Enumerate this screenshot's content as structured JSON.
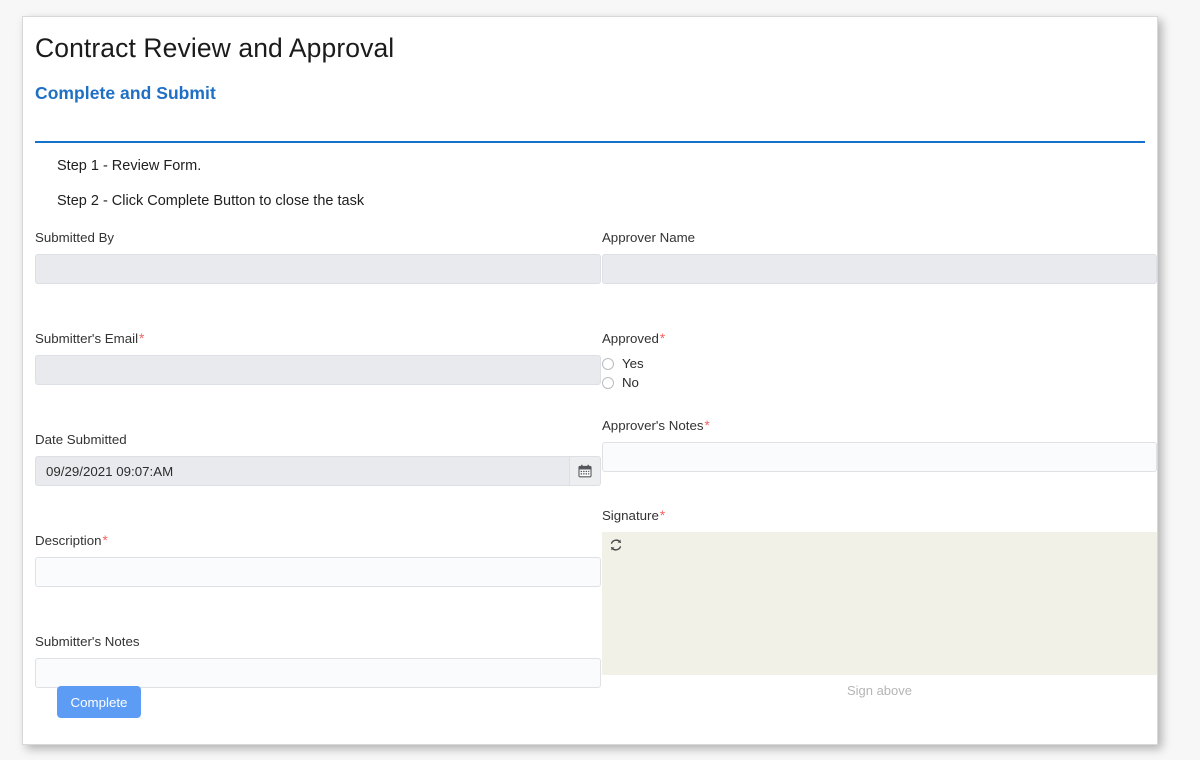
{
  "form": {
    "title": "Contract Review and Approval",
    "subtitle": "Complete and Submit",
    "steps": [
      "Step 1 - Review Form.",
      "Step 2 - Click Complete Button to close the task"
    ],
    "accent_color": "#1472cc",
    "required_marker": "*"
  },
  "left_column": {
    "submitted_by": {
      "label": "Submitted By",
      "value": "",
      "required": false,
      "disabled": true
    },
    "submitter_email": {
      "label": "Submitter's Email",
      "value": "",
      "required": true,
      "disabled": true
    },
    "date_submitted": {
      "label": "Date Submitted",
      "value": "09/29/2021 09:07:AM",
      "required": false,
      "disabled": true,
      "icon": "calendar-icon"
    },
    "description": {
      "label": "Description",
      "value": "",
      "required": true,
      "disabled": false
    },
    "submitter_notes": {
      "label": "Submitter's Notes",
      "value": "",
      "required": false,
      "disabled": false
    }
  },
  "right_column": {
    "approver_name": {
      "label": "Approver Name",
      "value": "",
      "required": false,
      "disabled": true
    },
    "approved": {
      "label": "Approved",
      "required": true,
      "selected": null,
      "options": [
        {
          "label": "Yes",
          "value": "yes",
          "checked": false
        },
        {
          "label": "No",
          "value": "no",
          "checked": false
        }
      ]
    },
    "approver_notes": {
      "label": "Approver's Notes",
      "value": "",
      "required": true,
      "disabled": false
    },
    "signature": {
      "label": "Signature",
      "required": true,
      "caption": "Sign above",
      "refresh_icon": "refresh-icon",
      "pad_color": "#f1f1e8"
    }
  },
  "actions": {
    "complete_label": "Complete",
    "complete_color": "#5d9cf5"
  }
}
